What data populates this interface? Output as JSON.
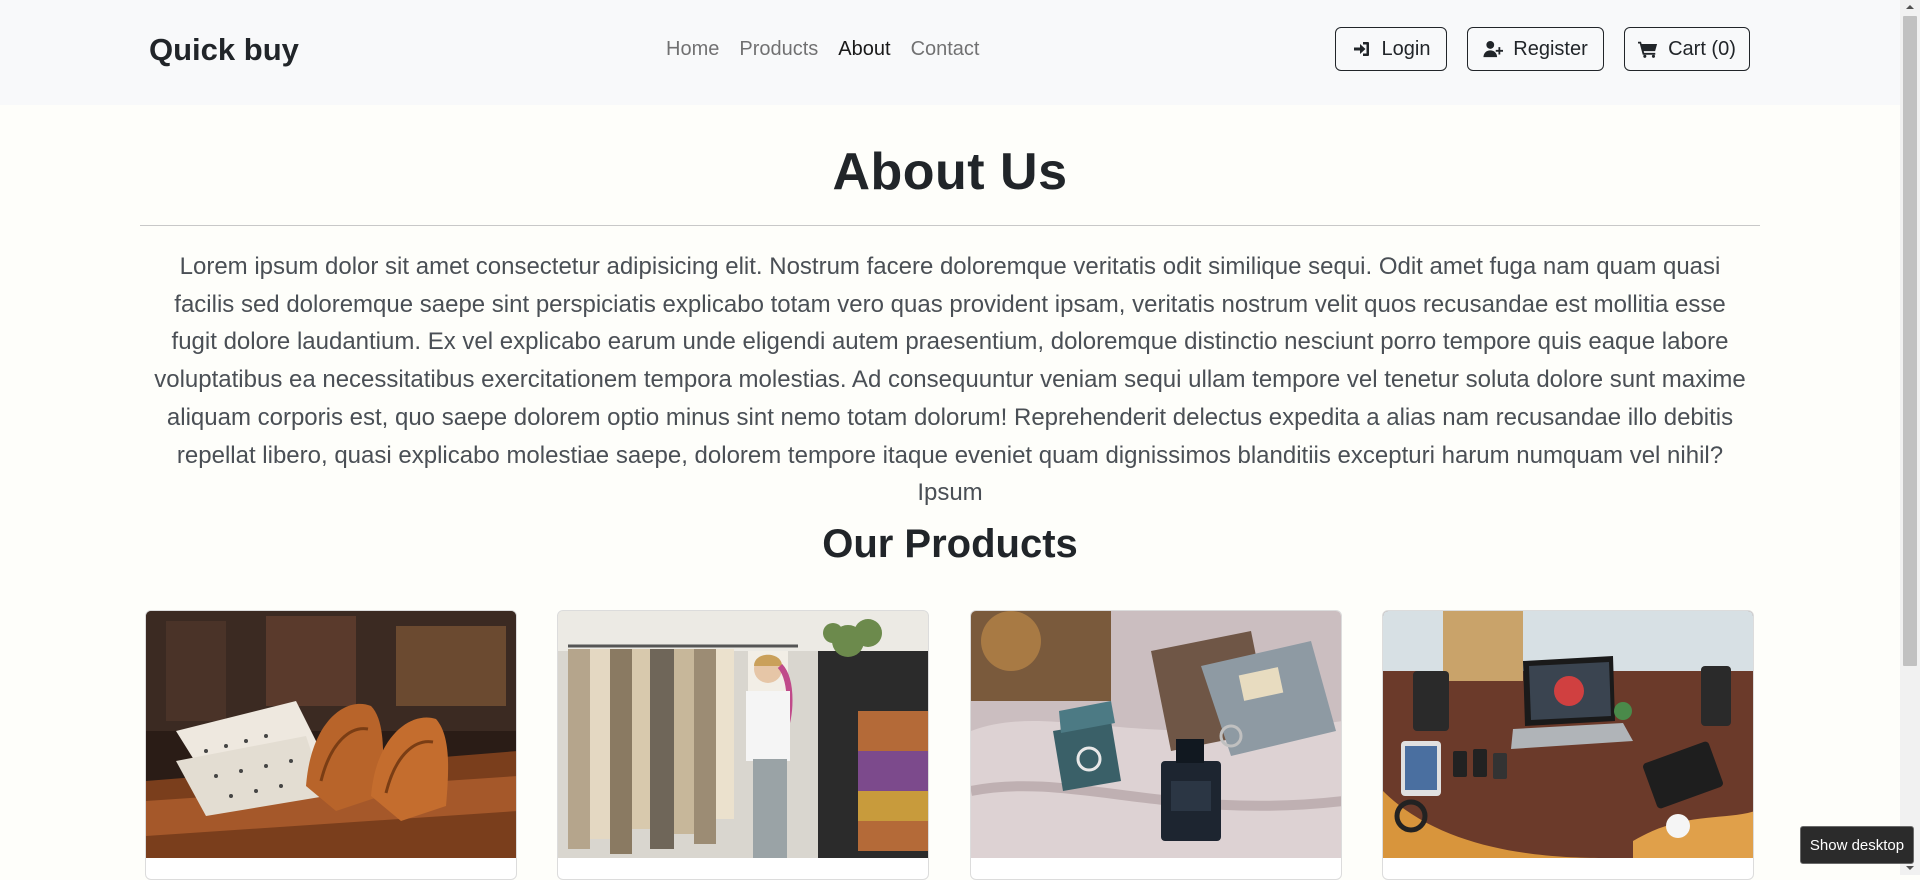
{
  "navbar": {
    "brand": "Quick buy",
    "links": [
      {
        "label": "Home",
        "active": false
      },
      {
        "label": "Products",
        "active": false
      },
      {
        "label": "About",
        "active": true
      },
      {
        "label": "Contact",
        "active": false
      }
    ],
    "login_label": "Login",
    "register_label": "Register",
    "cart_label": "Cart (0)"
  },
  "about": {
    "title": "About Us",
    "body": "Lorem ipsum dolor sit amet consectetur adipisicing elit. Nostrum facere doloremque veritatis odit similique sequi. Odit amet fuga nam quam quasi facilis sed doloremque saepe sint perspiciatis explicabo totam vero quas provident ipsam, veritatis nostrum velit quos recusandae est mollitia esse fugit dolore laudantium. Ex vel explicabo earum unde eligendi autem praesentium, doloremque distinctio nesciunt porro tempore quis eaque labore voluptatibus ea necessitatibus exercitationem tempora molestias. Ad consequuntur veniam sequi ullam tempore vel tenetur soluta dolore sunt maxime aliquam corporis est, quo saepe dolorem optio minus sint nemo totam dolorum! Reprehenderit delectus expedita a alias nam recusandae illo debitis repellat libero, quasi explicabo molestiae saepe, dolorem tempore itaque eveniet quam dignissimos blanditiis excepturi harum numquam vel nihil? Ipsum"
  },
  "products": {
    "title": "Our Products",
    "cards": [
      {
        "image": "shirts-and-shoes-photo"
      },
      {
        "image": "clothing-store-photo"
      },
      {
        "image": "jewelry-and-perfume-photo"
      },
      {
        "image": "electronics-desk-photo"
      }
    ]
  },
  "tooltip": "Show desktop"
}
